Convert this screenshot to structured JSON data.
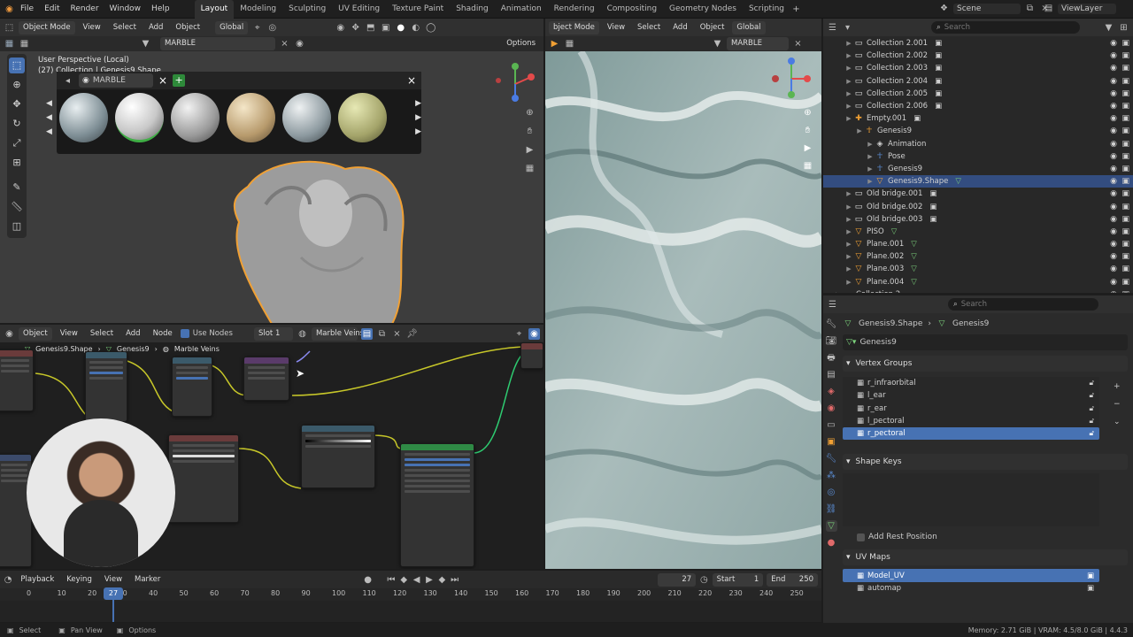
{
  "menu": {
    "items": [
      "File",
      "Edit",
      "Render",
      "Window",
      "Help"
    ],
    "workspaces": [
      "Layout",
      "Modeling",
      "Sculpting",
      "UV Editing",
      "Texture Paint",
      "Shading",
      "Animation",
      "Rendering",
      "Compositing",
      "Geometry Nodes",
      "Scripting"
    ],
    "active_workspace": "Layout",
    "scene": "Scene",
    "view_layer": "ViewLayer"
  },
  "viewport": {
    "mode": "Object Mode",
    "menus": [
      "View",
      "Select",
      "Add",
      "Object"
    ],
    "transform": "Global",
    "search_value": "MARBLE",
    "options": "Options",
    "info_line1": "User Perspective (Local)",
    "info_line2": "(27) Collection | Genesis9.Shape",
    "asset_search": "MARBLE",
    "asset_add": "+",
    "asset_close": "×",
    "panel_close": "×"
  },
  "image_editor": {
    "mode": "bject Mode",
    "menus": [
      "View",
      "Select",
      "Add",
      "Object"
    ],
    "transform": "Global",
    "search_value": "MARBLE"
  },
  "outliner": {
    "search_placeholder": "Search",
    "rows": [
      {
        "label": "Collection 2.001",
        "indent": 2,
        "type": "coll"
      },
      {
        "label": "Collection 2.002",
        "indent": 2,
        "type": "coll"
      },
      {
        "label": "Collection 2.003",
        "indent": 2,
        "type": "coll"
      },
      {
        "label": "Collection 2.004",
        "indent": 2,
        "type": "coll"
      },
      {
        "label": "Collection 2.005",
        "indent": 2,
        "type": "coll"
      },
      {
        "label": "Collection 2.006",
        "indent": 2,
        "type": "coll"
      },
      {
        "label": "Empty.001",
        "indent": 2,
        "type": "empty"
      },
      {
        "label": "Genesis9",
        "indent": 3,
        "type": "armature"
      },
      {
        "label": "Animation",
        "indent": 4,
        "type": "anim"
      },
      {
        "label": "Pose",
        "indent": 4,
        "type": "pose"
      },
      {
        "label": "Genesis9",
        "indent": 4,
        "type": "data"
      },
      {
        "label": "Genesis9.Shape",
        "indent": 4,
        "type": "mesh",
        "selected": true
      },
      {
        "label": "Old bridge.001",
        "indent": 2,
        "type": "coll"
      },
      {
        "label": "Old bridge.002",
        "indent": 2,
        "type": "coll"
      },
      {
        "label": "Old bridge.003",
        "indent": 2,
        "type": "coll"
      },
      {
        "label": "PISO",
        "indent": 2,
        "type": "mesh"
      },
      {
        "label": "Plane.001",
        "indent": 2,
        "type": "mesh"
      },
      {
        "label": "Plane.002",
        "indent": 2,
        "type": "mesh"
      },
      {
        "label": "Plane.003",
        "indent": 2,
        "type": "mesh"
      },
      {
        "label": "Plane.004",
        "indent": 2,
        "type": "mesh"
      },
      {
        "label": "Collection 2",
        "indent": 1,
        "type": "coll"
      }
    ]
  },
  "properties": {
    "search_placeholder": "Search",
    "breadcrumb_object": "Genesis9.Shape",
    "breadcrumb_data": "Genesis9",
    "data_name": "Genesis9",
    "vertex_groups_title": "Vertex Groups",
    "vertex_groups": [
      "r_infraorbital",
      "l_ear",
      "r_ear",
      "l_pectoral",
      "r_pectoral"
    ],
    "shape_keys_title": "Shape Keys",
    "add_rest_position": "Add Rest Position",
    "uv_maps_title": "UV Maps",
    "uv_maps": [
      "Model_UV",
      "automap"
    ]
  },
  "node_editor": {
    "type": "Object",
    "menus": [
      "View",
      "Select",
      "Add",
      "Node"
    ],
    "use_nodes": "Use Nodes",
    "slot": "Slot 1",
    "material": "Marble Veins",
    "breadcrumb": [
      "Genesis9.Shape",
      "Genesis9",
      "Marble Veins"
    ]
  },
  "timeline": {
    "menus": [
      "Playback",
      "Keying",
      "View",
      "Marker"
    ],
    "current_frame": "27",
    "start_label": "Start",
    "start": "1",
    "end_label": "End",
    "end": "250",
    "ruler": [
      "0",
      "10",
      "20",
      "30",
      "40",
      "50",
      "60",
      "70",
      "80",
      "90",
      "100",
      "110",
      "120",
      "130",
      "140",
      "150",
      "160",
      "170",
      "180",
      "190",
      "200",
      "210",
      "220",
      "230",
      "240",
      "250"
    ]
  },
  "status_bar": {
    "select": "Select",
    "pan": "Pan View",
    "options": "Options",
    "stats": "Memory: 2.71 GiB | VRAM: 4.5/8.0 GiB | 4.4.3"
  }
}
